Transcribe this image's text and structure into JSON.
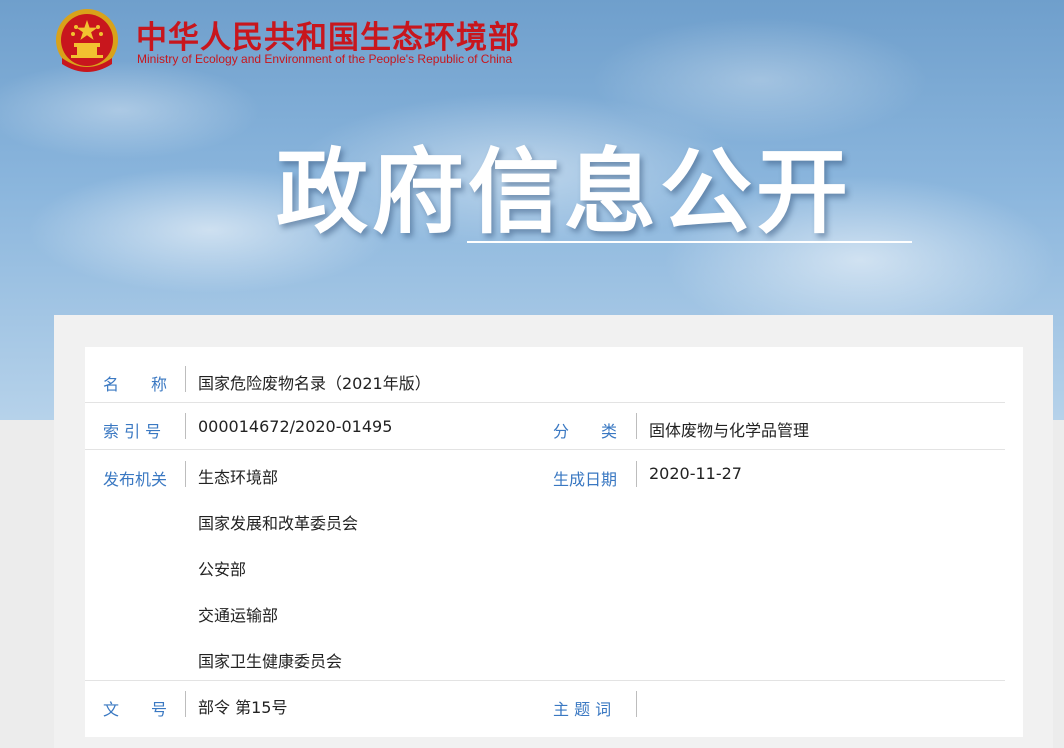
{
  "header": {
    "ministry_cn": "中华人民共和国生态环境部",
    "ministry_en": "Ministry of Ecology and Environment of the People's Republic of China",
    "emblem_icon": "national-emblem-icon",
    "hero_title": "政府信息公开"
  },
  "colors": {
    "brand_red": "#c8161d",
    "label_blue": "#3a78c2",
    "text": "#222222"
  },
  "info": {
    "name_label": "名　　称",
    "name_value": "国家危险废物名录（2021年版）",
    "index_label": "索 引 号",
    "index_value": "000014672/2020-01495",
    "category_label": "分　　类",
    "category_value": "固体废物与化学品管理",
    "issuer_label": "发布机关",
    "issuers": [
      "生态环境部",
      "国家发展和改革委员会",
      "公安部",
      "交通运输部",
      "国家卫生健康委员会"
    ],
    "date_label": "生成日期",
    "date_value": "2020-11-27",
    "doc_no_label": "文　　号",
    "doc_no_value": "部令 第15号",
    "keywords_label": "主 题 词",
    "keywords_value": ""
  }
}
